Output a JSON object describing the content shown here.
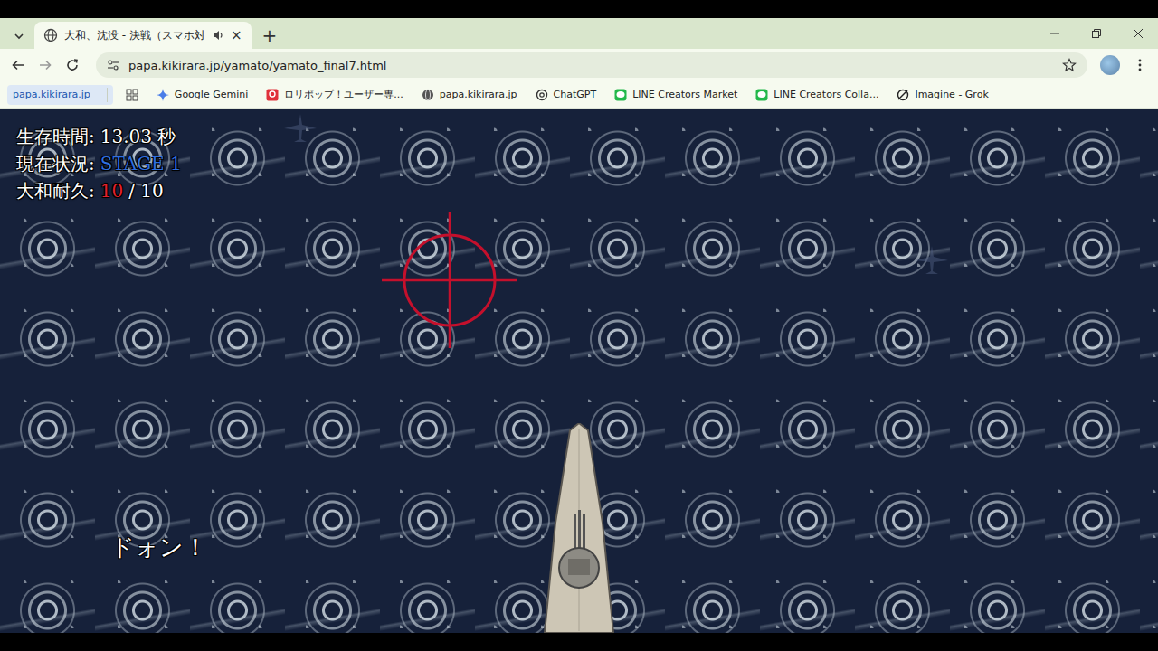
{
  "browser": {
    "tabs": [
      {
        "title": "大和、沈没 - 決戦（スマホ対",
        "selected": true,
        "close": "×"
      }
    ],
    "new_tab": "+",
    "address_bar": {
      "url": "papa.kikirara.jp/yamato/yamato_final7.html"
    },
    "bookmarks": [
      {
        "label": "papa.kikirara.jp",
        "selected": true,
        "kind": "chip"
      },
      {
        "label": "",
        "selected": false,
        "kind": "apps"
      },
      {
        "label": "Google Gemini",
        "selected": false,
        "kind": "gemini"
      },
      {
        "label": "ロリポップ！ユーザー専...",
        "selected": false,
        "kind": "lolipop"
      },
      {
        "label": "papa.kikirara.jp",
        "selected": false,
        "kind": "globe"
      },
      {
        "label": "ChatGPT",
        "selected": false,
        "kind": "chatgpt"
      },
      {
        "label": "LINE Creators Market",
        "selected": false,
        "kind": "line"
      },
      {
        "label": "LINE Creators Colla...",
        "selected": false,
        "kind": "line"
      },
      {
        "label": "Imagine - Grok",
        "selected": false,
        "kind": "grok"
      }
    ]
  },
  "game": {
    "hud": [
      {
        "label": "生存時間:",
        "value": "13.03 秒",
        "suffix": "",
        "color": "#ffffff"
      },
      {
        "label": "現在状況:",
        "value": "STAGE 1",
        "suffix": "",
        "color": "#2f6fe0"
      },
      {
        "label": "大和耐久:",
        "value": "10",
        "suffix": "/ 10",
        "color": "#e3202c"
      }
    ],
    "effect_text": "ドォン！"
  }
}
